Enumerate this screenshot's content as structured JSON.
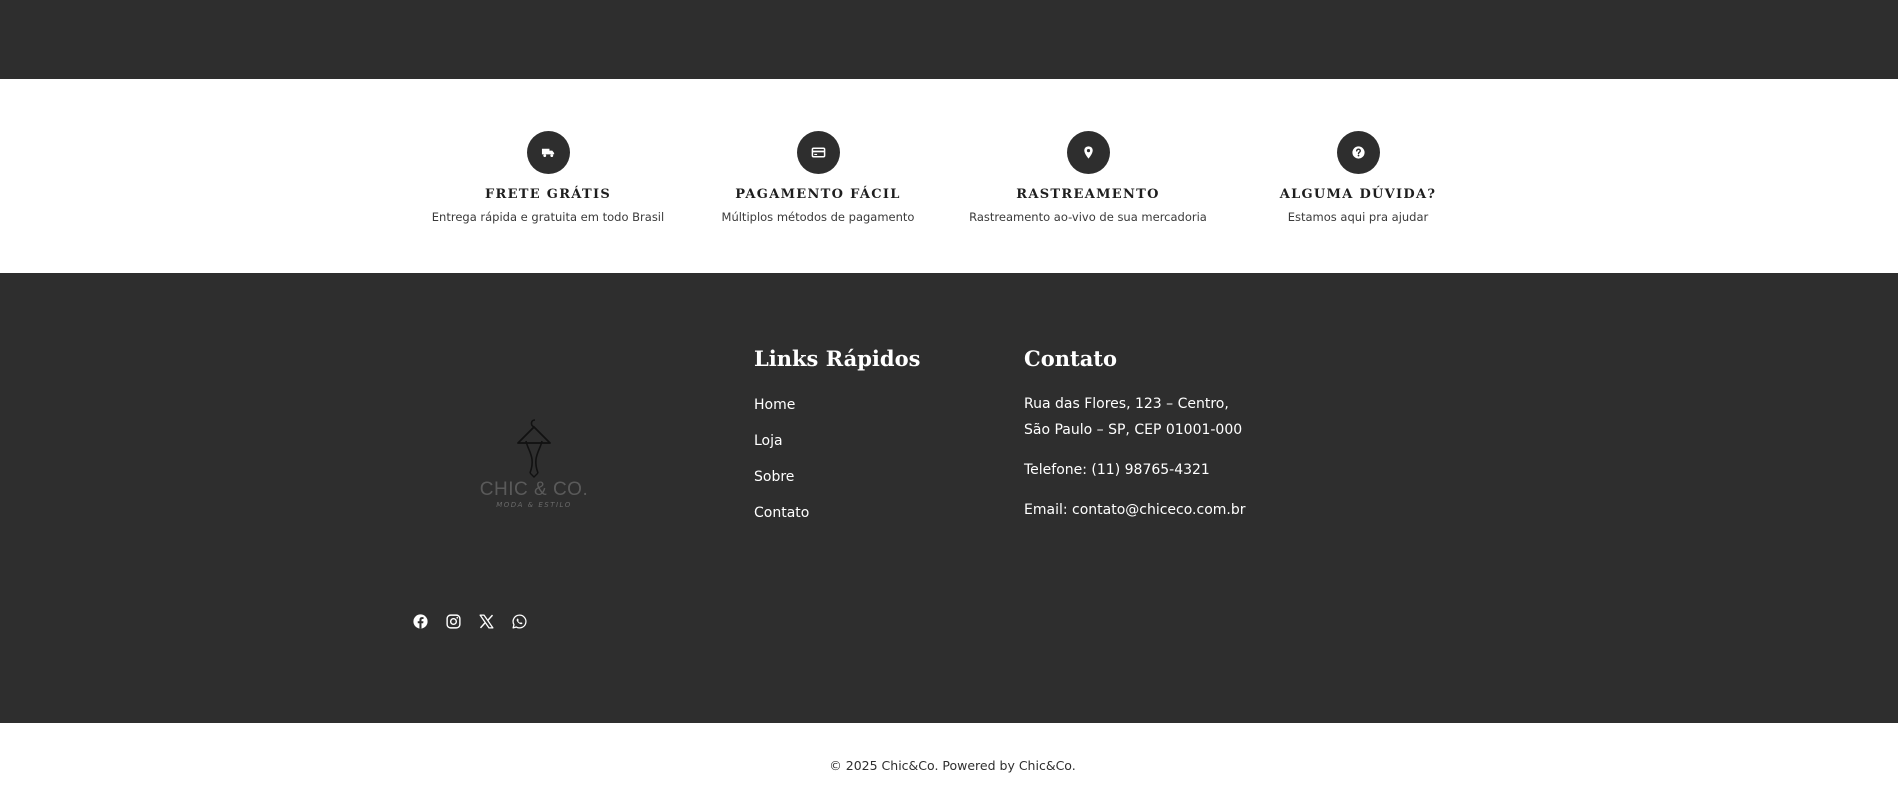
{
  "features": [
    {
      "icon": "truck-icon",
      "title": "FRETE GRÁTIS",
      "description": "Entrega rápida e gratuita em todo Brasil"
    },
    {
      "icon": "credit-card-icon",
      "title": "PAGAMENTO FÁCIL",
      "description": "Múltiplos métodos de pagamento"
    },
    {
      "icon": "map-pin-icon",
      "title": "RASTREAMENTO",
      "description": "Rastreamento ao-vivo de sua mercadoria"
    },
    {
      "icon": "question-circle-icon",
      "title": "ALGUMA DÚVIDA?",
      "description": "Estamos aqui pra ajudar"
    }
  ],
  "footer": {
    "logo": {
      "brand": "CHIC & CO.",
      "tagline": "MODA & ESTILO"
    },
    "quick_links": {
      "title": "Links Rápidos",
      "items": [
        "Home",
        "Loja",
        "Sobre",
        "Contato"
      ]
    },
    "contact": {
      "title": "Contato",
      "address_line1": "Rua das Flores, 123 – Centro,",
      "address_line2": "São Paulo – SP, CEP 01001-000",
      "phone": "Telefone: (11) 98765-4321",
      "email": "Email: contato@chiceco.com.br"
    },
    "socials": [
      "facebook-icon",
      "instagram-icon",
      "x-twitter-icon",
      "whatsapp-icon"
    ]
  },
  "bottom_bar": {
    "copyright": "© 2025 Chic&Co. Powered by Chic&Co."
  },
  "colors": {
    "dark": "#2e2e2e",
    "light": "#ffffff"
  }
}
